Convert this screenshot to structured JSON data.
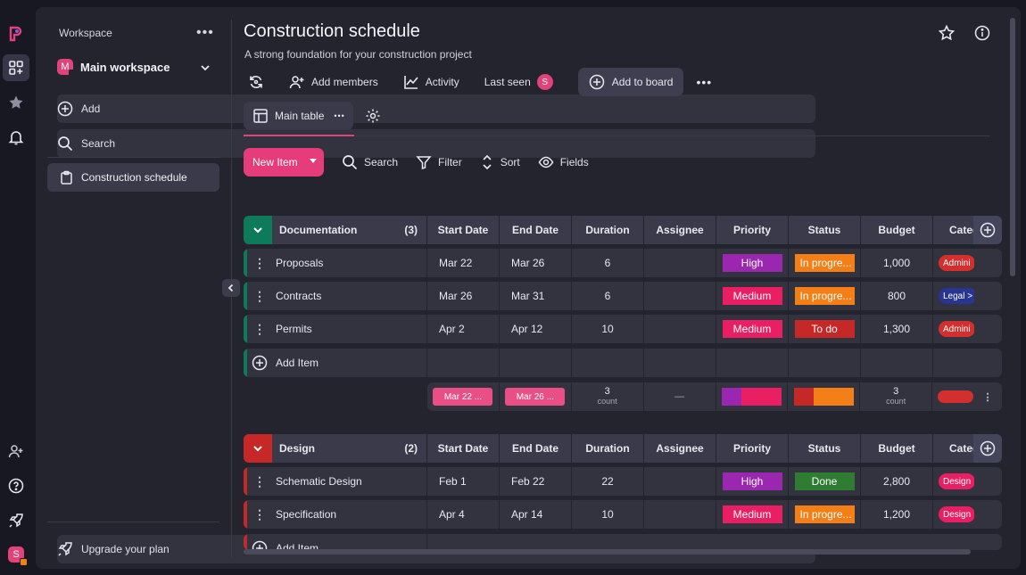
{
  "sidebar": {
    "workspace_label": "Workspace",
    "main_workspace": "Main workspace",
    "main_workspace_initial": "M",
    "add_label": "Add",
    "search_label": "Search",
    "board_item": "Construction schedule",
    "upgrade_label": "Upgrade your plan"
  },
  "rail": {
    "user_initial": "S"
  },
  "header": {
    "title": "Construction schedule",
    "subtitle": "A strong foundation for your construction project",
    "add_members": "Add members",
    "activity": "Activity",
    "last_seen": "Last seen",
    "last_seen_initial": "S",
    "add_to_board": "Add to board"
  },
  "view": {
    "tab_label": "Main table"
  },
  "toolbar": {
    "new_item": "New Item",
    "search": "Search",
    "filter": "Filter",
    "sort": "Sort",
    "fields": "Fields"
  },
  "columns": [
    "Start Date",
    "End Date",
    "Duration",
    "Assignee",
    "Priority",
    "Status",
    "Budget",
    "Categ"
  ],
  "groups": [
    {
      "name": "Documentation",
      "count": "(3)",
      "color": "#0d7a5a",
      "rows": [
        {
          "name": "Proposals",
          "start": "Mar 22",
          "end": "Mar 26",
          "duration": "6",
          "assignee": "",
          "priority": "High",
          "priority_color": "#9b27b0",
          "status": "In progre...",
          "status_color": "#f57f17",
          "budget": "1,000",
          "category": "Admini",
          "category_color": "#d32f2f"
        },
        {
          "name": "Contracts",
          "start": "Mar 26",
          "end": "Mar 31",
          "duration": "6",
          "assignee": "",
          "priority": "Medium",
          "priority_color": "#e91e63",
          "status": "In progre...",
          "status_color": "#f57f17",
          "budget": "800",
          "category": "Legal >",
          "category_color": "#283593"
        },
        {
          "name": "Permits",
          "start": "Apr 2",
          "end": "Apr 12",
          "duration": "10",
          "assignee": "",
          "priority": "Medium",
          "priority_color": "#e91e63",
          "status": "To do",
          "status_color": "#c62828",
          "budget": "1,300",
          "category": "Admini",
          "category_color": "#d32f2f"
        }
      ],
      "add_item": "Add Item",
      "summary": {
        "start": "Mar 22 ...",
        "end": "Mar 26 ...",
        "duration": "3",
        "duration_sub": "count",
        "assignee": "—",
        "budget": "3",
        "budget_sub": "count"
      }
    },
    {
      "name": "Design",
      "count": "(2)",
      "color": "#c62828",
      "rows": [
        {
          "name": "Schematic Design",
          "start": "Feb 1",
          "end": "Feb 22",
          "duration": "22",
          "assignee": "",
          "priority": "High",
          "priority_color": "#9b27b0",
          "status": "Done",
          "status_color": "#2e7d32",
          "budget": "2,800",
          "category": "Design",
          "category_color": "#e91e63"
        },
        {
          "name": "Specification",
          "start": "Apr 4",
          "end": "Apr 14",
          "duration": "10",
          "assignee": "",
          "priority": "Medium",
          "priority_color": "#e91e63",
          "status": "In progre...",
          "status_color": "#f57f17",
          "budget": "1,200",
          "category": "Design",
          "category_color": "#e91e63"
        }
      ],
      "add_item": "Add Item"
    }
  ]
}
